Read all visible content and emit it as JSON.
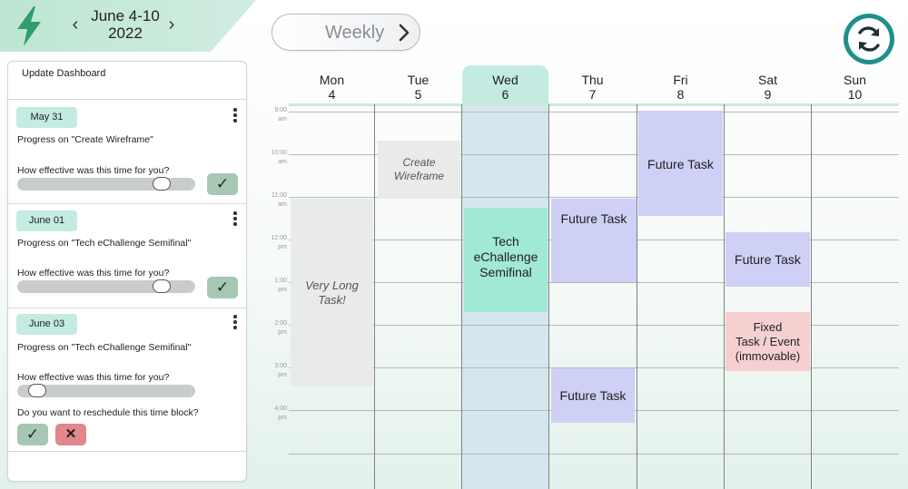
{
  "header": {
    "week_prev_icon": "chevron-left-icon",
    "week_label_line1": "June 4-10",
    "week_label_line2": "2022",
    "week_next_icon": "chevron-right-icon",
    "view_label": "Weekly",
    "view_icon": "chevron-right-icon",
    "sync_icon": "sync-icon",
    "brand_icon": "lightning-bolt-icon"
  },
  "dashboard": {
    "title": "Update Dashboard",
    "cards": [
      {
        "date": "May 31",
        "progress": "Progress on \"Create Wireframe\"",
        "question": "How effective was this time for you?",
        "slider_value": 0.85,
        "confirm": "✓"
      },
      {
        "date": "June 01",
        "progress": "Progress on \"Tech eChallenge Semifinal\"",
        "question": "How effective was this time for you?",
        "slider_value": 0.85,
        "confirm": "✓"
      },
      {
        "date": "June 03",
        "progress": "Progress on \"Tech eChallenge Semifinal\"",
        "question": "How effective was this time for you?",
        "slider_value": 0.1,
        "reschedule_question": "Do you want to reschedule this time block?",
        "confirm": "✓",
        "cancel": "✕"
      }
    ]
  },
  "calendar": {
    "days": [
      {
        "name": "Mon",
        "date": "4"
      },
      {
        "name": "Tue",
        "date": "5"
      },
      {
        "name": "Wed",
        "date": "6"
      },
      {
        "name": "Thu",
        "date": "7"
      },
      {
        "name": "Fri",
        "date": "8"
      },
      {
        "name": "Sat",
        "date": "9"
      },
      {
        "name": "Sun",
        "date": "10"
      }
    ],
    "times": [
      {
        "hour": "9:00",
        "ampm": "am"
      },
      {
        "hour": "10:00",
        "ampm": "am"
      },
      {
        "hour": "11:00",
        "ampm": "am"
      },
      {
        "hour": "12:00",
        "ampm": "pm"
      },
      {
        "hour": "1:00",
        "ampm": "pm"
      },
      {
        "hour": "2:00",
        "ampm": "pm"
      },
      {
        "hour": "3:00",
        "ampm": "pm"
      },
      {
        "hour": "4:00",
        "ampm": "pm"
      }
    ],
    "events": {
      "create_wireframe_line1": "Create",
      "create_wireframe_line2": "Wireframe",
      "very_long_task_line1": "Very Long",
      "very_long_task_line2": "Task!",
      "tech_line1": "Tech",
      "tech_line2": "eChallenge",
      "tech_line3": "Semifinal",
      "thu_future_1": "Future Task",
      "thu_future_2": "Future Task",
      "fri_future": "Future Task",
      "sat_future": "Future Task",
      "fixed_line1": "Fixed",
      "fixed_line2": "Task / Event",
      "fixed_line3": "(immovable)"
    }
  },
  "colors": {
    "accent_teal": "#1f8f8a",
    "bolt_green": "#2e9e6e",
    "future_task": "#cfd0f6",
    "current_task": "#a2e8d6",
    "fixed_task": "#f6d0d0",
    "past_task": "#e9eaea"
  }
}
